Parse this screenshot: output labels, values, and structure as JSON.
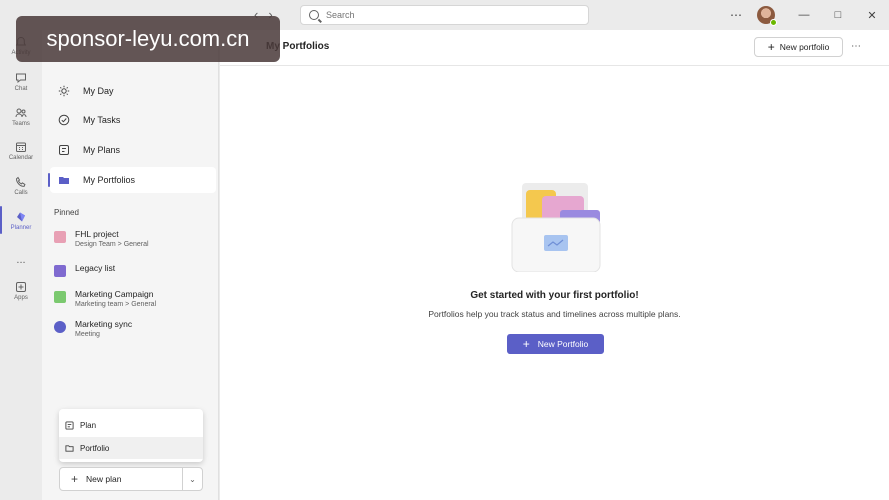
{
  "search": {
    "placeholder": "Search"
  },
  "rail": {
    "items": [
      {
        "label": "Activity",
        "icon": "bell-icon"
      },
      {
        "label": "Chat",
        "icon": "chat-icon"
      },
      {
        "label": "Teams",
        "icon": "teams-icon"
      },
      {
        "label": "Calendar",
        "icon": "calendar-icon"
      },
      {
        "label": "Calls",
        "icon": "phone-icon"
      },
      {
        "label": "Planner",
        "icon": "planner-icon"
      },
      {
        "label": "Apps",
        "icon": "apps-icon"
      }
    ],
    "more": "..."
  },
  "sidebar": {
    "nav": [
      {
        "label": "My Day",
        "icon": "sun-icon"
      },
      {
        "label": "My Tasks",
        "icon": "task-icon"
      },
      {
        "label": "My Plans",
        "icon": "plans-icon"
      },
      {
        "label": "My Portfolios",
        "icon": "portfolio-icon"
      }
    ],
    "pinned_header": "Pinned",
    "pinned": [
      {
        "title": "FHL project",
        "subtitle": "Design Team > General",
        "color": "#e8a0b4"
      },
      {
        "title": "Legacy list",
        "subtitle": "",
        "color": "#7f6ad0"
      },
      {
        "title": "Marketing Campaign",
        "subtitle": "Marketing team > General",
        "color": "#7bc96f"
      },
      {
        "title": "Marketing sync",
        "subtitle": "Meeting",
        "color": "#5b5fc7"
      }
    ],
    "create_menu": [
      {
        "label": "Plan",
        "icon": "plan-icon"
      },
      {
        "label": "Portfolio",
        "icon": "folder-icon"
      }
    ],
    "new_plan_label": "New plan"
  },
  "main": {
    "title": "My Portfolios",
    "header_button": "New portfolio",
    "empty_title": "Get started with your first portfolio!",
    "empty_subtitle": "Portfolios help you track status and timelines across multiple plans.",
    "cta_label": "New Portfolio"
  },
  "watermark": "sponsor-leyu.com.cn",
  "colors": {
    "accent": "#5b5fc7",
    "background": "#ebebeb",
    "panel": "#f5f5f5"
  }
}
